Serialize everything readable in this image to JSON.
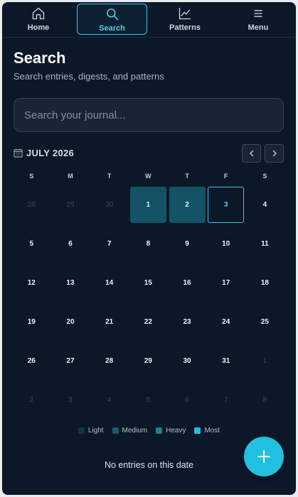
{
  "nav": {
    "tabs": [
      {
        "label": "Home",
        "icon": "home-icon"
      },
      {
        "label": "Search",
        "icon": "search-icon",
        "active": true
      },
      {
        "label": "Patterns",
        "icon": "chart-line-icon"
      },
      {
        "label": "Menu",
        "icon": "hamburger-menu-icon"
      }
    ]
  },
  "page": {
    "title": "Search",
    "subtitle": "Search entries, digests, and patterns"
  },
  "search": {
    "placeholder": "Search your journal...",
    "value": ""
  },
  "calendar": {
    "month_label": "JULY 2026",
    "weekdays": [
      "S",
      "M",
      "T",
      "W",
      "T",
      "F",
      "S"
    ],
    "today": 3,
    "days": [
      {
        "n": "28",
        "other": true
      },
      {
        "n": "29",
        "other": true
      },
      {
        "n": "30",
        "other": true
      },
      {
        "n": "1",
        "level": "medium"
      },
      {
        "n": "2",
        "level": "medium"
      },
      {
        "n": "3",
        "today": true
      },
      {
        "n": "4"
      },
      {
        "n": "5"
      },
      {
        "n": "6"
      },
      {
        "n": "7"
      },
      {
        "n": "8"
      },
      {
        "n": "9"
      },
      {
        "n": "10"
      },
      {
        "n": "11"
      },
      {
        "n": "12"
      },
      {
        "n": "13"
      },
      {
        "n": "14"
      },
      {
        "n": "15"
      },
      {
        "n": "16"
      },
      {
        "n": "17"
      },
      {
        "n": "18"
      },
      {
        "n": "19"
      },
      {
        "n": "20"
      },
      {
        "n": "21"
      },
      {
        "n": "22"
      },
      {
        "n": "23"
      },
      {
        "n": "24"
      },
      {
        "n": "25"
      },
      {
        "n": "26"
      },
      {
        "n": "27"
      },
      {
        "n": "28"
      },
      {
        "n": "29"
      },
      {
        "n": "30"
      },
      {
        "n": "31"
      },
      {
        "n": "1",
        "other": true
      },
      {
        "n": "2",
        "other": true
      },
      {
        "n": "3",
        "other": true
      },
      {
        "n": "4",
        "other": true
      },
      {
        "n": "5",
        "other": true
      },
      {
        "n": "6",
        "other": true
      },
      {
        "n": "7",
        "other": true
      },
      {
        "n": "8",
        "other": true
      }
    ]
  },
  "legend": [
    {
      "label": "Light",
      "color": "#14354a"
    },
    {
      "label": "Medium",
      "color": "#1a5a6e"
    },
    {
      "label": "Heavy",
      "color": "#1a7f95"
    },
    {
      "label": "Most",
      "color": "#22c0e0"
    }
  ],
  "status": {
    "empty_text": "No entries on this date"
  },
  "colors": {
    "accent": "#35c7e6",
    "background": "#0c1828"
  }
}
